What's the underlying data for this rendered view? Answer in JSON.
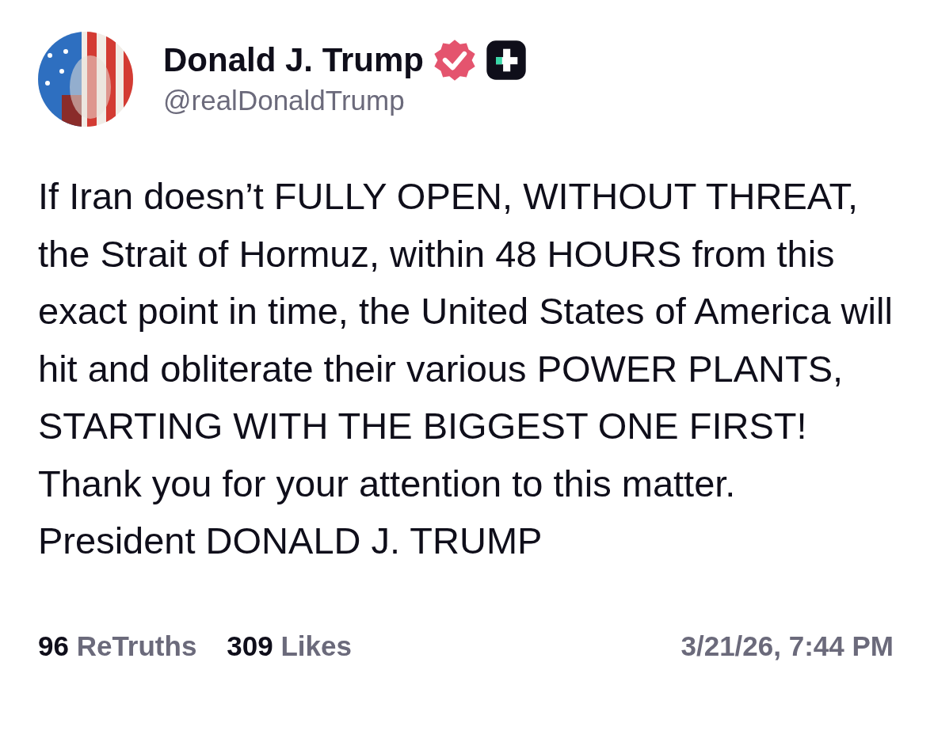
{
  "author": {
    "name": "Donald J. Trump",
    "handle": "@realDonaldTrump",
    "verified": true
  },
  "body": [
    "If Iran doesn’t FULLY OPEN, WITHOUT THREAT, the Strait of Hormuz, within 48 HOURS from this exact point in time, the United States of America will hit and obliterate their various POWER PLANTS, STARTING WITH THE BIGGEST ONE FIRST!",
    "Thank you for your attention to this matter.",
    "President DONALD J. TRUMP"
  ],
  "stats": [
    {
      "count": "96",
      "label": "ReTruths"
    },
    {
      "count": "309",
      "label": "Likes"
    }
  ],
  "timestamp": "3/21/26, 7:44 PM"
}
